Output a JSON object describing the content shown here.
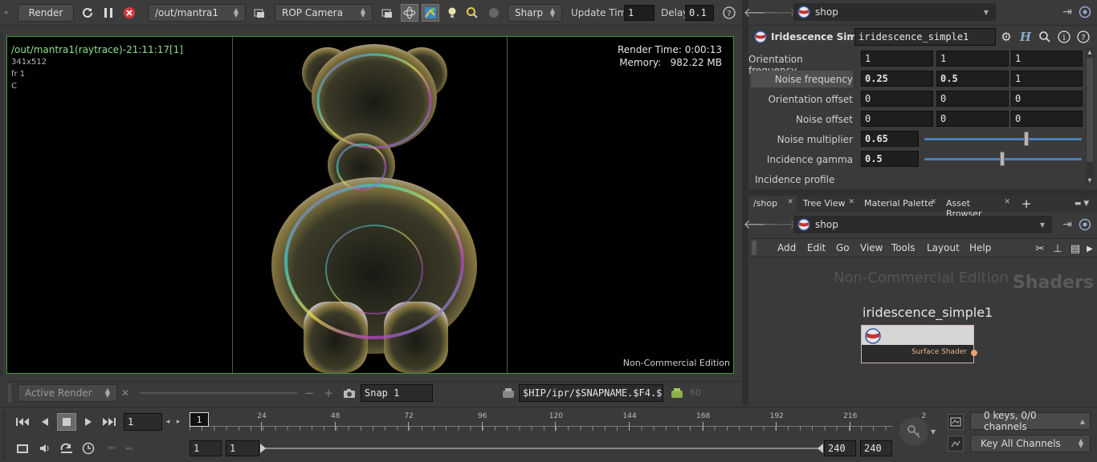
{
  "render_toolbar": {
    "render_label": "Render",
    "rop_path": "/out/mantra1",
    "camera": "ROP Camera",
    "quality": "Sharp",
    "update_time_label": "Update Time",
    "update_time_value": "1",
    "delay_label": "Delay",
    "delay_value": "0.1"
  },
  "viewport": {
    "title": "/out/mantra1(raytrace)-21:11:17[1]",
    "resolution": "341x512",
    "frame": "fr 1",
    "channel": "C",
    "render_time": "Render Time: 0:00:13",
    "memory": "Memory:   982.22 MB",
    "watermark": "Non-Commercial Edition"
  },
  "snapshot_bar": {
    "mode": "Active Render",
    "snap_name": "Snap 1",
    "path": "$HIP/ipr/$SNAPNAME.$F4.$",
    "count": "60"
  },
  "timeline": {
    "current_frame": "1",
    "frame_marker": "1",
    "ticks": [
      "24",
      "48",
      "72",
      "96",
      "120",
      "144",
      "168",
      "192",
      "216",
      "2"
    ],
    "range_start": "1",
    "range_start2": "1",
    "range_end": "240",
    "range_end2": "240",
    "keys_info": "0 keys, 0/0 channels",
    "key_mode": "Key All Channels"
  },
  "param_pane": {
    "network": "shop",
    "node_type": "Iridescence Simple",
    "node_name": "iridescence_simple1",
    "params": [
      {
        "label": "Orientation frequency",
        "v": [
          "1",
          "1",
          "1"
        ]
      },
      {
        "label": "Noise frequency",
        "v": [
          "0.25",
          "0.5",
          "1"
        ]
      },
      {
        "label": "Orientation offset",
        "v": [
          "0",
          "0",
          "0"
        ]
      },
      {
        "label": "Noise offset",
        "v": [
          "0",
          "0",
          "0"
        ]
      }
    ],
    "noise_multiplier_label": "Noise multiplier",
    "noise_multiplier": "0.65",
    "noise_multiplier_level": 0.6,
    "incidence_gamma_label": "Incidence gamma",
    "incidence_gamma": "0.5",
    "incidence_gamma_level": 0.5,
    "incidence_profile_label": "Incidence profile"
  },
  "network_pane": {
    "tabs": [
      "/shop",
      "Tree View",
      "Material Palette",
      "Asset Browser"
    ],
    "path": "shop",
    "menu": [
      "Add",
      "Edit",
      "Go",
      "View",
      "Tools",
      "Layout",
      "Help"
    ],
    "edition": "Non-Commercial Edition",
    "context": "Shaders",
    "node_name": "iridescence_simple1",
    "node_output": "Surface Shader"
  }
}
